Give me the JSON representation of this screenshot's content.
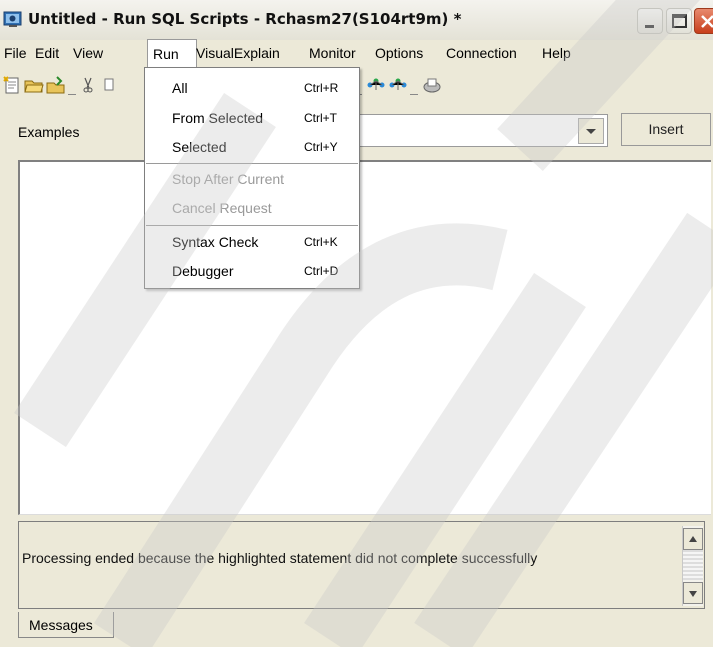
{
  "window": {
    "title": "Untitled - Run SQL Scripts - Rchasm27(S104rt9m) *",
    "title_controls": [
      "minimize-icon",
      "maximize-icon",
      "close-icon"
    ]
  },
  "menubar": {
    "items": [
      {
        "label": "File"
      },
      {
        "label": "Edit"
      },
      {
        "label": "View"
      },
      {
        "label": "Run"
      },
      {
        "label": "VisualExplain"
      },
      {
        "label": "Monitor"
      },
      {
        "label": "Options"
      },
      {
        "label": "Connection"
      },
      {
        "label": "Help"
      }
    ],
    "open_menu": "Run"
  },
  "toolbar": {
    "icons": [
      "new-script-icon",
      "open-icon",
      "save-icon",
      "cut-icon",
      "stop-icon",
      "explain-icon",
      "explain-run-icon",
      "print-icon"
    ]
  },
  "run_menu": {
    "items": [
      {
        "label": "All",
        "shortcut": "Ctrl+R",
        "enabled": true
      },
      {
        "label": "From Selected",
        "shortcut": "Ctrl+T",
        "enabled": true
      },
      {
        "label": "Selected",
        "shortcut": "Ctrl+Y",
        "enabled": true
      },
      {
        "label": "Stop After Current",
        "shortcut": "",
        "enabled": false
      },
      {
        "label": "Cancel Request",
        "shortcut": "",
        "enabled": false
      },
      {
        "label": "Syntax Check",
        "shortcut": "Ctrl+K",
        "enabled": true
      },
      {
        "label": "Debugger",
        "shortcut": "Ctrl+D",
        "enabled": true
      }
    ]
  },
  "examples": {
    "label": "Examples",
    "selected_value": "",
    "insert_label": "Insert"
  },
  "editor": {
    "content": ""
  },
  "messages": {
    "text": "Processing ended because the highlighted statement did not complete successfully",
    "tab_label": "Messages"
  },
  "colors": {
    "window_bg": "#ece9d8",
    "close_button": "#c73e1c",
    "disabled_text": "#9a9a9a"
  }
}
